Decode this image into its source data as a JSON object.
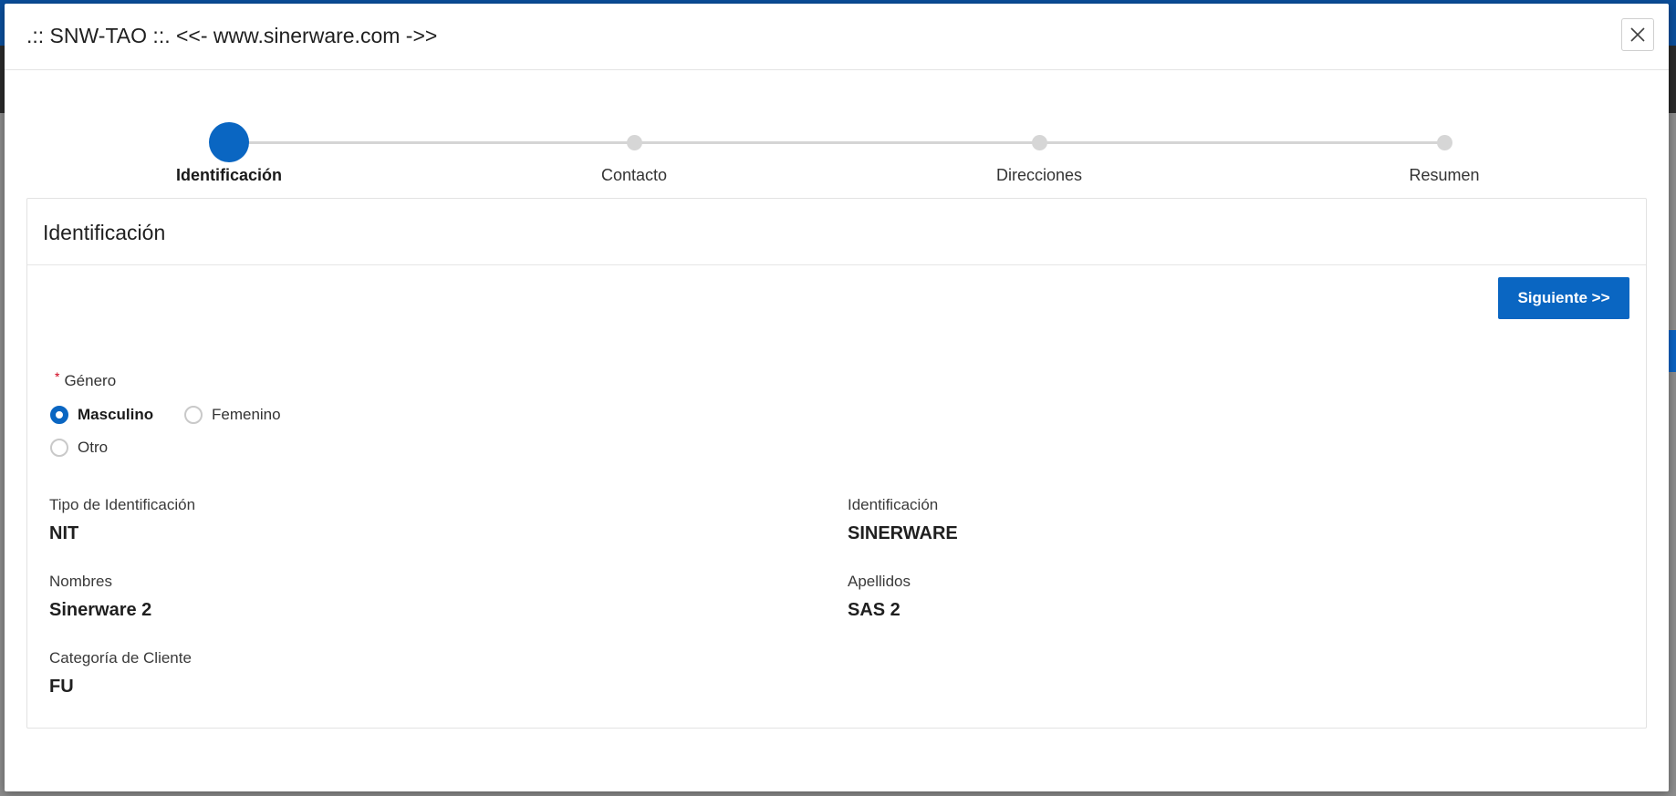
{
  "modal": {
    "title": ".:: SNW-TAO ::. <<- www.sinerware.com ->>",
    "close_icon": "close-icon"
  },
  "stepper": {
    "steps": [
      {
        "label": "Identificación",
        "active": true
      },
      {
        "label": "Contacto",
        "active": false
      },
      {
        "label": "Direcciones",
        "active": false
      },
      {
        "label": "Resumen",
        "active": false
      }
    ]
  },
  "panel": {
    "title": "Identificación",
    "next_label": "Siguiente >>"
  },
  "gender": {
    "required_mark": "*",
    "label": "Género",
    "options": [
      {
        "label": "Masculino",
        "checked": true
      },
      {
        "label": "Femenino",
        "checked": false
      },
      {
        "label": "Otro",
        "checked": false
      }
    ]
  },
  "fields": {
    "tipo_identificacion": {
      "label": "Tipo de Identificación",
      "value": "NIT"
    },
    "identificacion": {
      "label": "Identificación",
      "value": "SINERWARE"
    },
    "nombres": {
      "label": "Nombres",
      "value": "Sinerware 2"
    },
    "apellidos": {
      "label": "Apellidos",
      "value": "SAS 2"
    },
    "categoria_cliente": {
      "label": "Categoría de Cliente",
      "value": "FU"
    }
  },
  "colors": {
    "accent": "#0a66c2",
    "inactive_step": "#d6d6d6",
    "required": "#d0021b"
  }
}
